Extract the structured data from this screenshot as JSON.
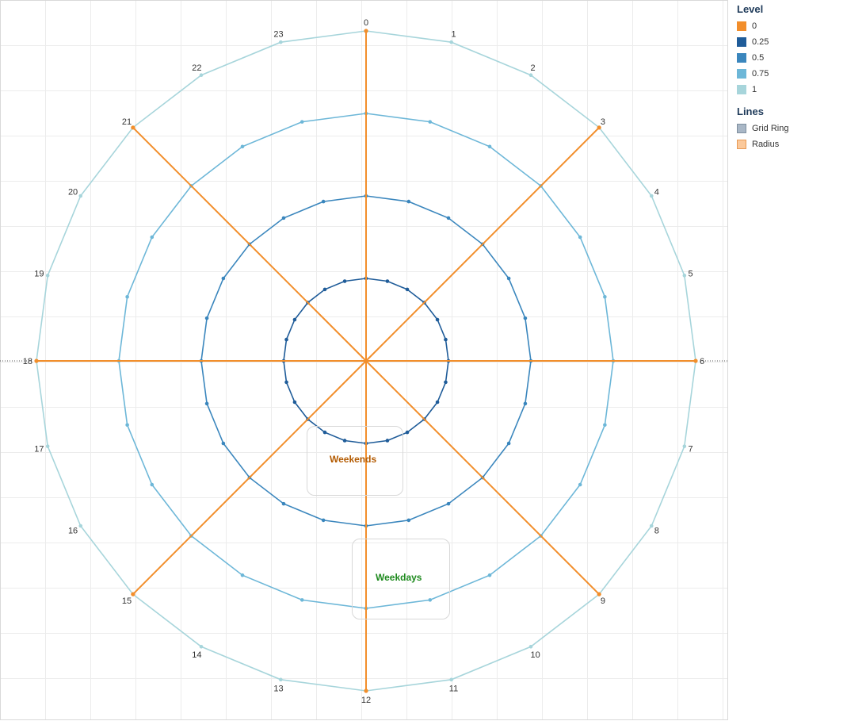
{
  "chart_data": {
    "type": "radar",
    "hours": [
      "0",
      "1",
      "2",
      "3",
      "4",
      "5",
      "6",
      "7",
      "8",
      "9",
      "10",
      "11",
      "12",
      "13",
      "14",
      "15",
      "16",
      "17",
      "18",
      "19",
      "20",
      "21",
      "22",
      "23"
    ],
    "levels": [
      0.25,
      0.5,
      0.75,
      1
    ],
    "radii_hours": [
      0,
      3,
      6,
      9,
      12,
      15,
      18,
      21
    ],
    "radius_max": 1,
    "annotations": [
      {
        "text": "Weekends",
        "color": "#b35a00"
      },
      {
        "text": "Weekdays",
        "color": "#1e8a1e"
      }
    ],
    "grid": true
  },
  "legend": {
    "level_title": "Level",
    "levels": [
      {
        "label": "0",
        "color": "#f28e2b"
      },
      {
        "label": "0.25",
        "color": "#1f5c99"
      },
      {
        "label": "0.5",
        "color": "#3a86bd"
      },
      {
        "label": "0.75",
        "color": "#6db7d8"
      },
      {
        "label": "1",
        "color": "#a7d5db"
      }
    ],
    "lines_title": "Lines",
    "lines": [
      {
        "label": "Grid Ring",
        "color": "#a9b7c6",
        "border": "#7f8f9f"
      },
      {
        "label": "Radius",
        "color": "#fbc99b",
        "border": "#e89a55"
      }
    ]
  }
}
